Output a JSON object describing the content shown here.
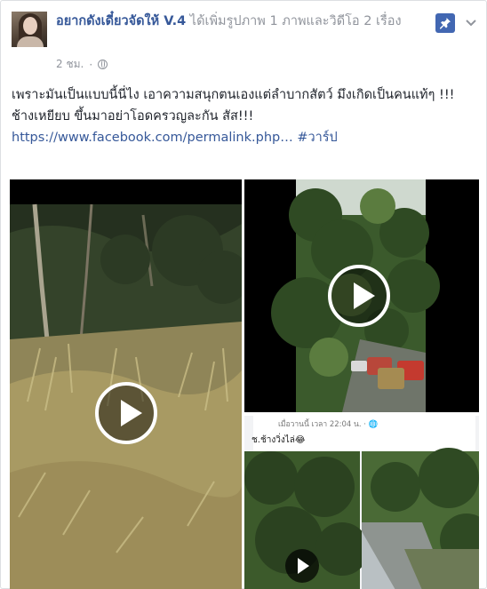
{
  "post": {
    "page_name": "อยากดังเดี๋ยวจัดให้ V.4",
    "action_text": "ได้เพิ่มรูปภาพ 1 ภาพและวิดีโอ 2 เรื่อง",
    "timestamp": "2 ชม.",
    "privacy_icon": "globe-icon",
    "text_line1": "เพราะมันเป็นแบบนี้นี่ไง เอาความสนุกตนเองแต่ลำบากสัตว์ มึงเกิดเป็นคนแท้ๆ !!!",
    "text_line2": "ช้างเหยียบ ขึ้นมาอย่าโอดครวญละกัน สัส!!!",
    "link_text": "https://www.facebook.com/permalink.php…",
    "hashtag": "#วาร์ป"
  },
  "embedded_screenshot": {
    "caption": "เมื่อวานนี้ เวลา 22:04 น. · 🌐",
    "comment": "ช.ช้างวิ่งไล่😂"
  },
  "icons": {
    "pin": "pin-icon",
    "menu": "chevron-down-icon",
    "play": "play-icon"
  },
  "colors": {
    "link": "#365899",
    "meta": "#90949c",
    "pin_button": "#4267b2"
  }
}
